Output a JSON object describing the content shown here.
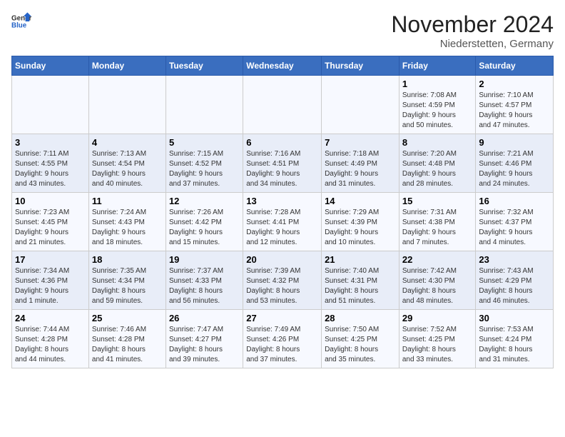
{
  "logo": {
    "text_general": "General",
    "text_blue": "Blue"
  },
  "header": {
    "month": "November 2024",
    "location": "Niederstetten, Germany"
  },
  "weekdays": [
    "Sunday",
    "Monday",
    "Tuesday",
    "Wednesday",
    "Thursday",
    "Friday",
    "Saturday"
  ],
  "weeks": [
    [
      {
        "day": "",
        "info": ""
      },
      {
        "day": "",
        "info": ""
      },
      {
        "day": "",
        "info": ""
      },
      {
        "day": "",
        "info": ""
      },
      {
        "day": "",
        "info": ""
      },
      {
        "day": "1",
        "info": "Sunrise: 7:08 AM\nSunset: 4:59 PM\nDaylight: 9 hours\nand 50 minutes."
      },
      {
        "day": "2",
        "info": "Sunrise: 7:10 AM\nSunset: 4:57 PM\nDaylight: 9 hours\nand 47 minutes."
      }
    ],
    [
      {
        "day": "3",
        "info": "Sunrise: 7:11 AM\nSunset: 4:55 PM\nDaylight: 9 hours\nand 43 minutes."
      },
      {
        "day": "4",
        "info": "Sunrise: 7:13 AM\nSunset: 4:54 PM\nDaylight: 9 hours\nand 40 minutes."
      },
      {
        "day": "5",
        "info": "Sunrise: 7:15 AM\nSunset: 4:52 PM\nDaylight: 9 hours\nand 37 minutes."
      },
      {
        "day": "6",
        "info": "Sunrise: 7:16 AM\nSunset: 4:51 PM\nDaylight: 9 hours\nand 34 minutes."
      },
      {
        "day": "7",
        "info": "Sunrise: 7:18 AM\nSunset: 4:49 PM\nDaylight: 9 hours\nand 31 minutes."
      },
      {
        "day": "8",
        "info": "Sunrise: 7:20 AM\nSunset: 4:48 PM\nDaylight: 9 hours\nand 28 minutes."
      },
      {
        "day": "9",
        "info": "Sunrise: 7:21 AM\nSunset: 4:46 PM\nDaylight: 9 hours\nand 24 minutes."
      }
    ],
    [
      {
        "day": "10",
        "info": "Sunrise: 7:23 AM\nSunset: 4:45 PM\nDaylight: 9 hours\nand 21 minutes."
      },
      {
        "day": "11",
        "info": "Sunrise: 7:24 AM\nSunset: 4:43 PM\nDaylight: 9 hours\nand 18 minutes."
      },
      {
        "day": "12",
        "info": "Sunrise: 7:26 AM\nSunset: 4:42 PM\nDaylight: 9 hours\nand 15 minutes."
      },
      {
        "day": "13",
        "info": "Sunrise: 7:28 AM\nSunset: 4:41 PM\nDaylight: 9 hours\nand 12 minutes."
      },
      {
        "day": "14",
        "info": "Sunrise: 7:29 AM\nSunset: 4:39 PM\nDaylight: 9 hours\nand 10 minutes."
      },
      {
        "day": "15",
        "info": "Sunrise: 7:31 AM\nSunset: 4:38 PM\nDaylight: 9 hours\nand 7 minutes."
      },
      {
        "day": "16",
        "info": "Sunrise: 7:32 AM\nSunset: 4:37 PM\nDaylight: 9 hours\nand 4 minutes."
      }
    ],
    [
      {
        "day": "17",
        "info": "Sunrise: 7:34 AM\nSunset: 4:36 PM\nDaylight: 9 hours\nand 1 minute."
      },
      {
        "day": "18",
        "info": "Sunrise: 7:35 AM\nSunset: 4:34 PM\nDaylight: 8 hours\nand 59 minutes."
      },
      {
        "day": "19",
        "info": "Sunrise: 7:37 AM\nSunset: 4:33 PM\nDaylight: 8 hours\nand 56 minutes."
      },
      {
        "day": "20",
        "info": "Sunrise: 7:39 AM\nSunset: 4:32 PM\nDaylight: 8 hours\nand 53 minutes."
      },
      {
        "day": "21",
        "info": "Sunrise: 7:40 AM\nSunset: 4:31 PM\nDaylight: 8 hours\nand 51 minutes."
      },
      {
        "day": "22",
        "info": "Sunrise: 7:42 AM\nSunset: 4:30 PM\nDaylight: 8 hours\nand 48 minutes."
      },
      {
        "day": "23",
        "info": "Sunrise: 7:43 AM\nSunset: 4:29 PM\nDaylight: 8 hours\nand 46 minutes."
      }
    ],
    [
      {
        "day": "24",
        "info": "Sunrise: 7:44 AM\nSunset: 4:28 PM\nDaylight: 8 hours\nand 44 minutes."
      },
      {
        "day": "25",
        "info": "Sunrise: 7:46 AM\nSunset: 4:28 PM\nDaylight: 8 hours\nand 41 minutes."
      },
      {
        "day": "26",
        "info": "Sunrise: 7:47 AM\nSunset: 4:27 PM\nDaylight: 8 hours\nand 39 minutes."
      },
      {
        "day": "27",
        "info": "Sunrise: 7:49 AM\nSunset: 4:26 PM\nDaylight: 8 hours\nand 37 minutes."
      },
      {
        "day": "28",
        "info": "Sunrise: 7:50 AM\nSunset: 4:25 PM\nDaylight: 8 hours\nand 35 minutes."
      },
      {
        "day": "29",
        "info": "Sunrise: 7:52 AM\nSunset: 4:25 PM\nDaylight: 8 hours\nand 33 minutes."
      },
      {
        "day": "30",
        "info": "Sunrise: 7:53 AM\nSunset: 4:24 PM\nDaylight: 8 hours\nand 31 minutes."
      }
    ]
  ]
}
